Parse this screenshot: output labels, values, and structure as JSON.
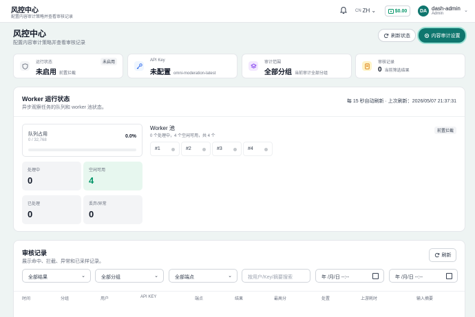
{
  "topbar": {
    "title": "风控中心",
    "subtitle": "配置内容审计策略并查看审核记录",
    "lang_prefix": "CN",
    "lang": "ZH",
    "balance": "$0.00",
    "avatar_initials": "DA",
    "user_name": "dash-admin",
    "user_role": "Admin"
  },
  "header": {
    "title": "风控中心",
    "subtitle": "配置内容审计策略并查看审核记录",
    "refresh_status_label": "刷新状态",
    "settings_label": "内容审计设置"
  },
  "stats": [
    {
      "label": "运行状态",
      "value": "未启用",
      "desc": "前置拦截",
      "badge": "未启用",
      "icon": "shield-icon",
      "color": "#f3f4f6"
    },
    {
      "label": "API Key",
      "value": "未配置",
      "desc": "omni-moderation-latest",
      "icon": "key-icon",
      "color": "#eff6ff"
    },
    {
      "label": "审计范围",
      "value": "全部分组",
      "desc": "当前审计全部分组",
      "icon": "layers-icon",
      "color": "#f3e8ff"
    },
    {
      "label": "审核记录",
      "value": "0",
      "desc": "当前筛选结果",
      "icon": "document-icon",
      "color": "#fef3c7"
    }
  ],
  "worker": {
    "title": "Worker 运行状态",
    "subtitle": "异步观察任务的队列和 worker 池状态。",
    "auto_refresh": "每 15 秒自动刷新 · 上次刷新：2026/05/07 21:37:31",
    "queue_label": "队列占用",
    "queue_count": "0 / 32,768",
    "queue_pct_text": "0.0%",
    "queue_fraction": 0.0,
    "metrics": [
      {
        "label": "处理中",
        "value": "0"
      },
      {
        "label": "空闲可用",
        "value": "4"
      },
      {
        "label": "已处理",
        "value": "0"
      },
      {
        "label": "丢弃/异常",
        "value": "0"
      }
    ],
    "pool_title": "Worker 池",
    "pool_sub": "0 个处理中，4 个空闲可用，共 4 个",
    "pool_badge": "前置拦截",
    "slots": [
      "#1",
      "#2",
      "#3",
      "#4"
    ]
  },
  "records": {
    "title": "审核记录",
    "subtitle": "展示命中、拦截、异常和已采样记录。",
    "refresh_label": "刷新",
    "filters": {
      "result": "全部结果",
      "group": "全部分组",
      "endpoint": "全部端点",
      "search_placeholder": "按用户/Key/摘要搜索",
      "date_start": "年 /月/日 --:--",
      "date_end": "年 /月/日 --:--"
    },
    "columns": [
      "时间",
      "分组",
      "用户",
      "API KEY",
      "端点",
      "结果",
      "最高分",
      "处置",
      "上游耗时",
      "输入摘要"
    ]
  }
}
